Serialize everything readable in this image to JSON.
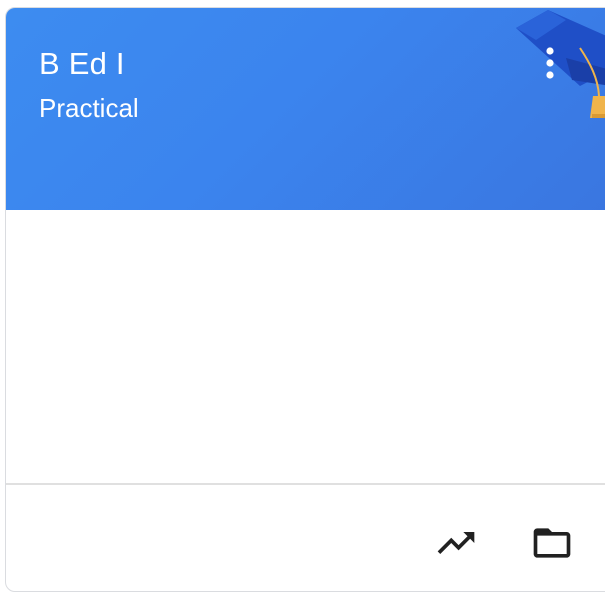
{
  "card": {
    "title": "B Ed I",
    "subtitle": "Practical"
  },
  "colors": {
    "header_background": "#3b84ee",
    "cap_body": "#1f4fc7",
    "tassel": "#f0b44b",
    "icon_color": "#212121"
  },
  "icons": {
    "more": "more-vert-icon",
    "decoration": "graduation-cap-icon",
    "trend": "trending-up-icon",
    "folder": "folder-icon"
  }
}
